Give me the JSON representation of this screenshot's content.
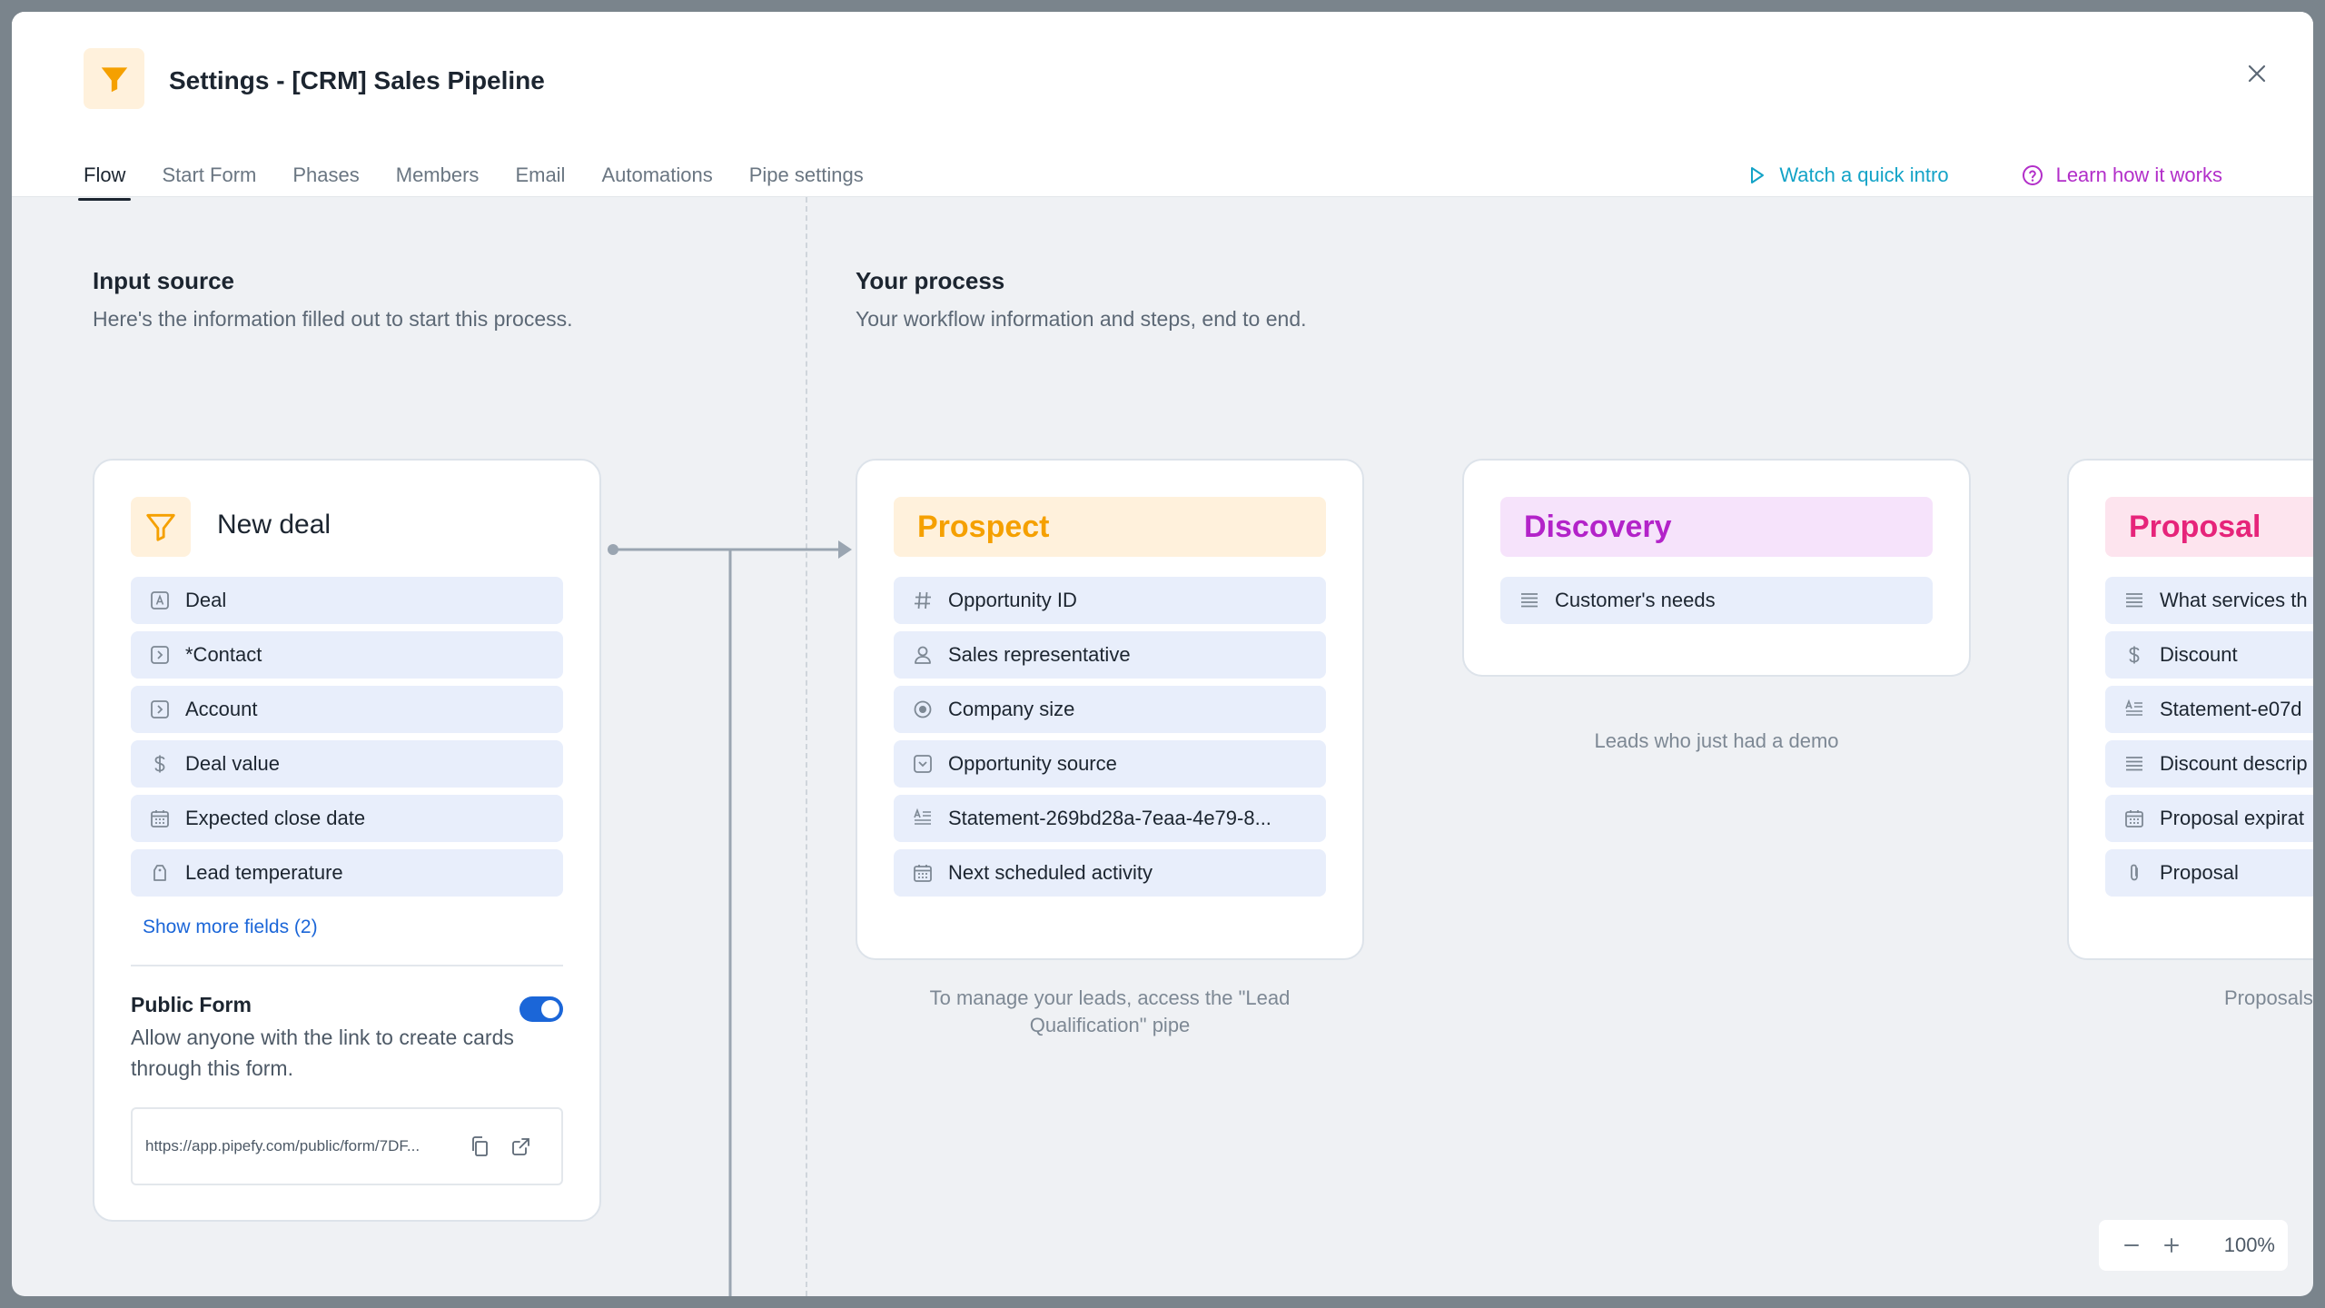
{
  "header": {
    "title": "Settings - [CRM] Sales Pipeline",
    "tabs": [
      {
        "label": "Flow"
      },
      {
        "label": "Start Form"
      },
      {
        "label": "Phases"
      },
      {
        "label": "Members"
      },
      {
        "label": "Email"
      },
      {
        "label": "Automations"
      },
      {
        "label": "Pipe settings"
      }
    ],
    "watch_label": "Watch a quick intro",
    "learn_label": "Learn how it works"
  },
  "input_source": {
    "title": "Input source",
    "subtitle": "Here's the information filled out to start this process.",
    "card": {
      "title": "New deal",
      "fields": [
        {
          "label": "Deal",
          "icon": "short-text-icon"
        },
        {
          "label": "*Contact",
          "icon": "connection-icon"
        },
        {
          "label": "Account",
          "icon": "connection-icon"
        },
        {
          "label": "Deal value",
          "icon": "dollar-icon"
        },
        {
          "label": "Expected close date",
          "icon": "calendar-icon"
        },
        {
          "label": "Lead temperature",
          "icon": "label-icon"
        }
      ],
      "show_more": "Show more fields (2)",
      "public_form_title": "Public Form",
      "public_form_desc": "Allow anyone with the link to create cards through this form.",
      "public_form_enabled": true,
      "url": "https://app.pipefy.com/public/form/7DF..."
    }
  },
  "process": {
    "title": "Your process",
    "subtitle": "Your workflow information and steps, end to end.",
    "phases": [
      {
        "name": "Prospect",
        "color": "#f5a000",
        "bg": "#fff1dc",
        "fields": [
          {
            "label": "Opportunity ID",
            "icon": "hash-icon"
          },
          {
            "label": "Sales representative",
            "icon": "user-icon"
          },
          {
            "label": "Company size",
            "icon": "radio-icon"
          },
          {
            "label": "Opportunity source",
            "icon": "dropdown-icon"
          },
          {
            "label": "Statement-269bd28a-7eaa-4e79-8...",
            "icon": "statement-icon"
          },
          {
            "label": "Next scheduled activity",
            "icon": "calendar-icon"
          }
        ],
        "description": "To manage your leads, access the \"Lead Qualification\" pipe"
      },
      {
        "name": "Discovery",
        "color": "#b323c9",
        "bg": "#f6e3fb",
        "fields": [
          {
            "label": "Customer's needs",
            "icon": "long-text-icon"
          }
        ],
        "description": "Leads who just had a demo"
      },
      {
        "name": "Proposal",
        "color": "#e6247a",
        "bg": "#fde4ee",
        "fields": [
          {
            "label": "What services th",
            "icon": "long-text-icon"
          },
          {
            "label": "Discount",
            "icon": "dollar-icon"
          },
          {
            "label": "Statement-e07d",
            "icon": "statement-icon"
          },
          {
            "label": "Discount descrip",
            "icon": "long-text-icon"
          },
          {
            "label": "Proposal expirat",
            "icon": "calendar-icon"
          },
          {
            "label": "Proposal",
            "icon": "attachment-icon"
          }
        ],
        "description": "Proposals"
      }
    ]
  },
  "zoom": {
    "value": "100%"
  }
}
